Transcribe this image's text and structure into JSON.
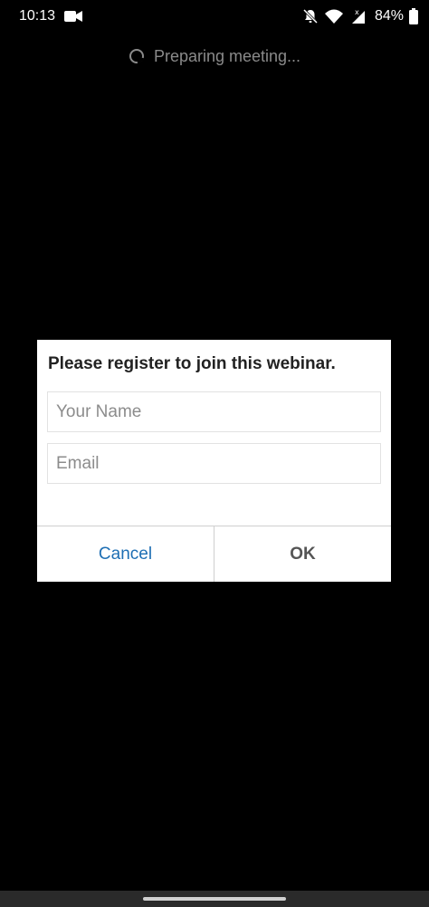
{
  "status_bar": {
    "time": "10:13",
    "battery_percent": "84%",
    "icons": [
      "video-icon",
      "bell-muted-icon",
      "wifi-icon",
      "cell-signal-icon",
      "battery-icon"
    ]
  },
  "loading": {
    "text": "Preparing meeting..."
  },
  "dialog": {
    "title": "Please register to join this webinar.",
    "name_placeholder": "Your Name",
    "name_value": "",
    "email_placeholder": "Email",
    "email_value": "",
    "cancel_label": "Cancel",
    "ok_label": "OK"
  },
  "colors": {
    "background": "#000000",
    "dialog_background": "#ffffff",
    "cancel_text": "#1e6fb4",
    "ok_text": "#555555",
    "loading_text": "#8a8a8a"
  }
}
